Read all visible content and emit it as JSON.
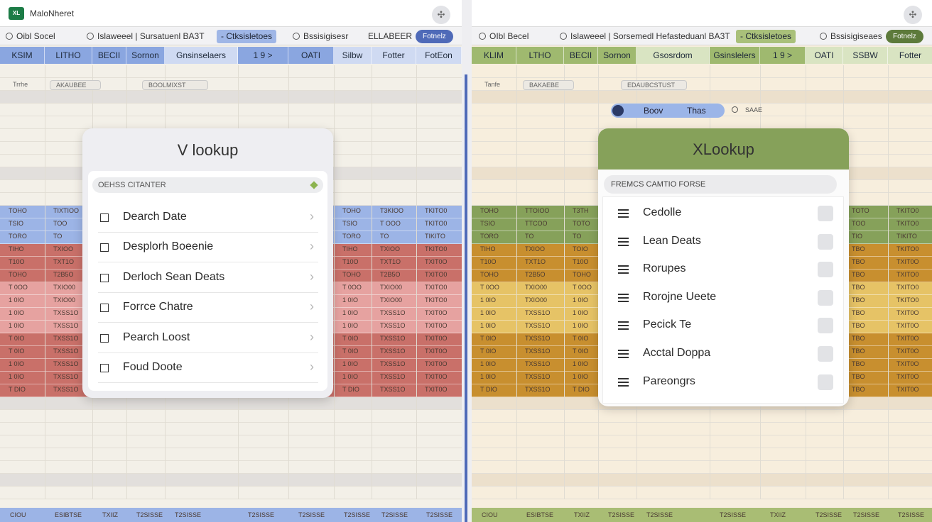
{
  "colors": {
    "left_accent": "#6d8fd0",
    "right_accent": "#86a15a",
    "red_row": "#c97069",
    "pink_row": "#e6a2a0",
    "orange_row": "#c88f2f",
    "yellow_row": "#e6c366",
    "blue_row": "#9cb4e6"
  },
  "left": {
    "window": {
      "icon_text": "XL",
      "title": "MaloNheret"
    },
    "ribbon": [
      {
        "label": "Oibl Socel",
        "radio": true
      },
      {
        "label": "Islaweeel | Sursatuenl BA3T",
        "radio": true
      },
      {
        "label": "- Ctksisletoes",
        "radio": false
      },
      {
        "label": "Bssisigisesr",
        "radio": true
      },
      {
        "label": "ELLABEER",
        "radio": false
      },
      {
        "label": "Fotnelz",
        "radio": false
      }
    ],
    "columns": [
      "KSIM",
      "LITHO",
      "BECII",
      "Sornon",
      "Gnsinselaers",
      "1 9 >",
      "OATI",
      "Silbw",
      "Fotter",
      "FotEon"
    ],
    "filters": [
      "Trrhe",
      "AKAUBEE",
      "BOOLMIXST"
    ],
    "data_rows": [
      {
        "tone": "blue",
        "cells": [
          "TOHO",
          "TIXTIOO",
          "",
          "",
          "",
          "",
          "",
          "TOHO",
          "T3KIOO",
          "TKITO0"
        ]
      },
      {
        "tone": "blue",
        "cells": [
          "TSIO",
          "TOO",
          "",
          "",
          "",
          "",
          "",
          "TSIO",
          "T OOO",
          "TKITO0"
        ]
      },
      {
        "tone": "blue",
        "cells": [
          "TORO",
          "TO",
          "",
          "",
          "",
          "",
          "",
          "TORO",
          "TO",
          "TIKITO"
        ]
      },
      {
        "tone": "red",
        "cells": [
          "TIHO",
          "TXIOO",
          "",
          "",
          "",
          "",
          "",
          "TIHO",
          "TXIOO",
          "TKITO0"
        ]
      },
      {
        "tone": "red",
        "cells": [
          "T10O",
          "TXT1O",
          "",
          "",
          "",
          "",
          "",
          "T10O",
          "TXT1O",
          "TXIT0O"
        ]
      },
      {
        "tone": "red",
        "cells": [
          "TOHO",
          "T2B5O",
          "",
          "",
          "",
          "",
          "",
          "TOHO",
          "T2B5O",
          "TXITO0"
        ]
      },
      {
        "tone": "pink",
        "cells": [
          "T 0OO",
          "TXIO00",
          "",
          "",
          "",
          "",
          "",
          "T 0OO",
          "TXIO00",
          "TXITO0"
        ]
      },
      {
        "tone": "pink",
        "cells": [
          "1 0IO",
          "TXIO00",
          "",
          "",
          "",
          "",
          "",
          "1 0IO",
          "TXIO00",
          "TKITO0"
        ]
      },
      {
        "tone": "pink",
        "cells": [
          "1 0IO",
          "TXSS1O",
          "",
          "",
          "",
          "",
          "",
          "1 0IO",
          "TXSS1O",
          "TXIT0O"
        ]
      },
      {
        "tone": "pink",
        "cells": [
          "1 0IO",
          "TXSS1O",
          "",
          "",
          "",
          "",
          "",
          "1 0IO",
          "TXSS1O",
          "TXIT0O"
        ]
      },
      {
        "tone": "red",
        "cells": [
          "T 0IO",
          "TXSS1O",
          "",
          "",
          "",
          "",
          "",
          "T 0IO",
          "TXSS1O",
          "TXIT0O"
        ]
      },
      {
        "tone": "red",
        "cells": [
          "T 0IO",
          "TXSS1O",
          "",
          "",
          "",
          "",
          "",
          "T 0IO",
          "TXSS1O",
          "TXIT0O"
        ]
      },
      {
        "tone": "red",
        "cells": [
          "1 0IO",
          "TXSS1O",
          "",
          "",
          "",
          "",
          "",
          "1 0IO",
          "TXSS1O",
          "TXIT0O"
        ]
      },
      {
        "tone": "red",
        "cells": [
          "1 0IO",
          "TXSS1O",
          "",
          "",
          "",
          "",
          "",
          "1 0IO",
          "TXSS1O",
          "TXIT0O"
        ]
      },
      {
        "tone": "red",
        "cells": [
          "T DIO",
          "TXSS1O",
          "",
          "",
          "",
          "",
          "",
          "T DIO",
          "TXSS1O",
          "TXIT0O"
        ]
      }
    ],
    "footer": [
      "CIOU",
      "ESIBTSE",
      "TXIIZ",
      "T2SISSE",
      "T2SISSE",
      "T2SISSE",
      "T2SISSE",
      "T2SISSE",
      "T2SISSE",
      "T2SISSE"
    ],
    "dialog": {
      "title": "V lookup",
      "search_placeholder": "OEHSS CITANTER",
      "items": [
        "Dearch Date",
        "Desplorh Boeenie",
        "Derloch Sean Deats",
        "Forrce Chatre",
        "Pearch Loost",
        "Foud Doote"
      ]
    }
  },
  "right": {
    "ribbon": [
      {
        "label": "OIbl Becel",
        "radio": true
      },
      {
        "label": "Islaweeel | Sorsemedl Hefasteduanl BA3T",
        "radio": true
      },
      {
        "label": "- Ctksisletoes",
        "radio": false
      },
      {
        "label": "Bssisigiseaes",
        "radio": true
      },
      {
        "label": "Fotnelz",
        "radio": false
      }
    ],
    "columns": [
      "KLIM",
      "LTHO",
      "BECII",
      "Sornon",
      "Gsosrdom",
      "Gsinslelers",
      "1 9 >",
      "OATI",
      "SSBW",
      "Fotter"
    ],
    "filters": [
      "Tanfe",
      "BAKAEBE",
      "EDAUBCSTUST"
    ],
    "toggle": {
      "left": "Boov",
      "right": "Thas"
    },
    "side_label": "SAAE",
    "data_rows": [
      {
        "tone": "green",
        "cells": [
          "TOHO",
          "TTOIOO",
          "T3TH",
          "",
          "",
          "",
          "",
          "",
          "TOTO",
          "TKITO0"
        ]
      },
      {
        "tone": "green",
        "cells": [
          "TSIO",
          "TTCOO",
          "TOTO",
          "",
          "",
          "",
          "",
          "",
          "TOO",
          "TKITO0"
        ]
      },
      {
        "tone": "green",
        "cells": [
          "TORO",
          "TO",
          "TO",
          "",
          "",
          "",
          "",
          "",
          "TIO",
          "TIKITO"
        ]
      },
      {
        "tone": "orange",
        "cells": [
          "TIHO",
          "TXIOO",
          "TOIO",
          "",
          "",
          "",
          "",
          "",
          "TBO",
          "TKITO0"
        ]
      },
      {
        "tone": "orange",
        "cells": [
          "T10O",
          "TXT1O",
          "T10O",
          "",
          "",
          "",
          "",
          "",
          "TBO",
          "TXIT0O"
        ]
      },
      {
        "tone": "orange",
        "cells": [
          "TOHO",
          "T2B5O",
          "TOHO",
          "",
          "",
          "",
          "",
          "",
          "TBO",
          "TXITO0"
        ]
      },
      {
        "tone": "yellow",
        "cells": [
          "T 0OO",
          "TXIO00",
          "T 0OO",
          "",
          "",
          "",
          "",
          "",
          "TBO",
          "TXITO0"
        ]
      },
      {
        "tone": "yellow",
        "cells": [
          "1 0IO",
          "TXIO00",
          "1 0IO",
          "",
          "",
          "",
          "",
          "",
          "TBO",
          "TKITO0"
        ]
      },
      {
        "tone": "yellow",
        "cells": [
          "1 0IO",
          "TXSS1O",
          "1 0IO",
          "",
          "",
          "",
          "",
          "",
          "TBO",
          "TXIT0O"
        ]
      },
      {
        "tone": "yellow",
        "cells": [
          "1 0IO",
          "TXSS1O",
          "1 0IO",
          "",
          "",
          "",
          "",
          "",
          "TBO",
          "TXIT0O"
        ]
      },
      {
        "tone": "orange",
        "cells": [
          "T 0IO",
          "TXSS1O",
          "T 0IO",
          "",
          "",
          "",
          "",
          "",
          "TBO",
          "TXIT0O"
        ]
      },
      {
        "tone": "orange",
        "cells": [
          "T 0IO",
          "TXSS1O",
          "T 0IO",
          "",
          "",
          "",
          "",
          "",
          "TBO",
          "TXIT0O"
        ]
      },
      {
        "tone": "orange",
        "cells": [
          "1 0IO",
          "TXSS1O",
          "1 0IO",
          "",
          "",
          "",
          "",
          "",
          "TBO",
          "TXIT0O"
        ]
      },
      {
        "tone": "orange",
        "cells": [
          "1 0IO",
          "TXSS1O",
          "1 0IO",
          "",
          "",
          "",
          "",
          "",
          "TBO",
          "TXIT0O"
        ]
      },
      {
        "tone": "orange",
        "cells": [
          "T DIO",
          "TXSS1O",
          "T DIO",
          "",
          "",
          "",
          "",
          "",
          "TBO",
          "TXIT0O"
        ]
      }
    ],
    "footer": [
      "CIOU",
      "ESIBTSE",
      "TXIIZ",
      "T2SISSE",
      "T2SISSE",
      "T2SISSE",
      "TXIIZ",
      "T2SISSE",
      "T2SISSE",
      "T2SISSE"
    ],
    "dialog": {
      "title": "XLookup",
      "search_placeholder": "FREMCS CAMTIO FORSE",
      "items": [
        "Cedolle",
        "Lean Deats",
        "Rorupes",
        "Rorojne Ueete",
        "Pecick Te",
        "Acctal Doppa",
        "Pareongrs"
      ]
    }
  }
}
